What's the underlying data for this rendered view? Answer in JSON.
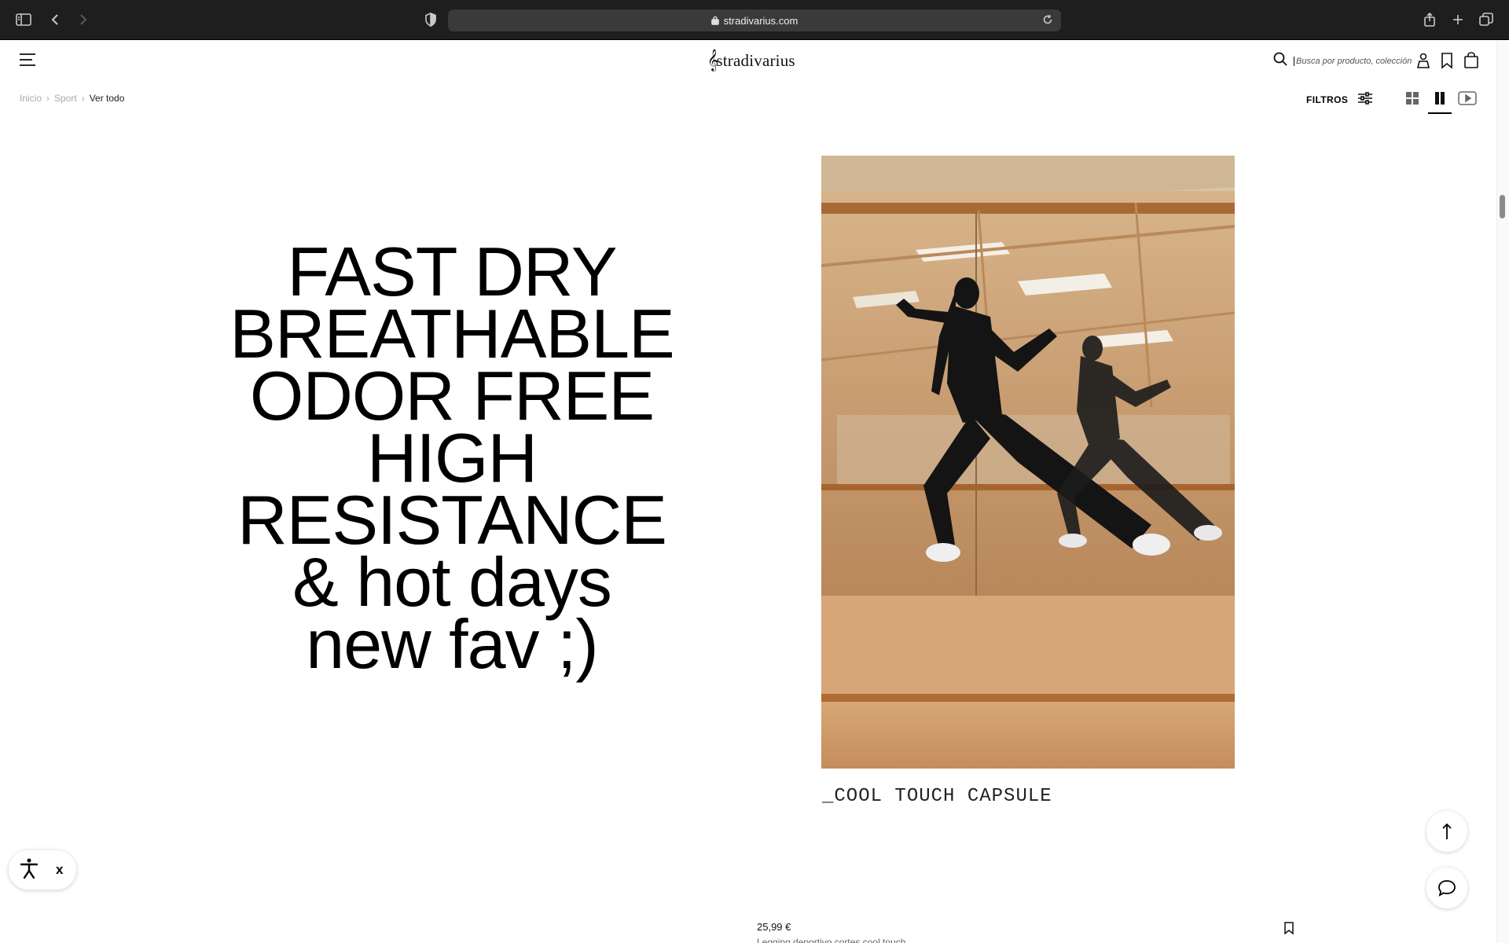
{
  "browser": {
    "url": "stradivarius.com"
  },
  "header": {
    "logo_text": "stradivarius",
    "search_placeholder": "Busca por producto, colección..."
  },
  "breadcrumb": {
    "items": [
      "Inicio",
      "Sport",
      "Ver todo"
    ]
  },
  "toolbar": {
    "filters_label": "FILTROS"
  },
  "promo": {
    "lines": [
      "FAST DRY",
      "BREATHABLE",
      "ODOR FREE",
      "HIGH",
      "RESISTANCE",
      "& hot days",
      "new fav ;)"
    ]
  },
  "campaign": {
    "caption": "_COOL TOUCH CAPSULE"
  },
  "product": {
    "price": "25,99 €",
    "name": "Legging deportivo cortes cool touch"
  },
  "accessibility": {
    "close_label": "x"
  },
  "colors": {
    "chrome_bg": "#1e1e1e",
    "urlbar_bg": "#3a3a3a",
    "page_bg": "#ffffff",
    "text": "#000000",
    "muted": "#aaaaaa"
  }
}
